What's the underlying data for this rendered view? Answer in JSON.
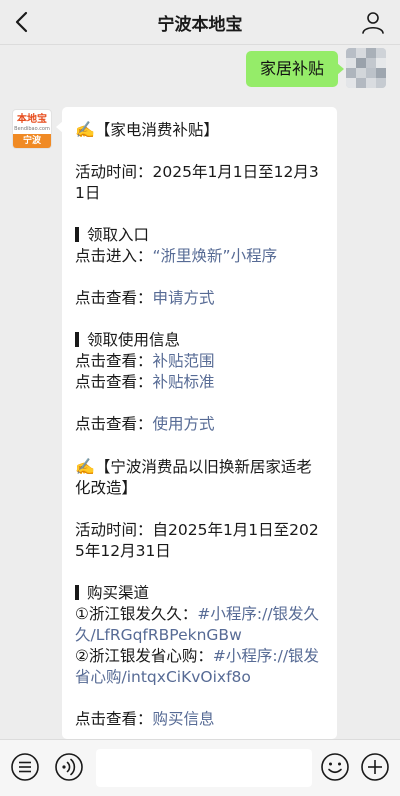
{
  "header": {
    "title": "宁波本地宝"
  },
  "outgoing": {
    "text": "家居补贴"
  },
  "bot_avatar": {
    "logo_text": "本地宝",
    "logo_sub": "Bendibao.com",
    "city": "宁波"
  },
  "reply": {
    "s1_title": "【家电消费补贴】",
    "s1_time": "活动时间：2025年1月1日至12月31日",
    "s1_h1": "领取入口",
    "s1_entry_prefix": "点击进入：",
    "s1_entry_link": "“浙里焕新”小程序",
    "s1_apply_prefix": "点击查看：",
    "s1_apply_link": "申请方式",
    "s1_h2": "领取使用信息",
    "s1_scope_prefix": "点击查看：",
    "s1_scope_link": "补贴范围",
    "s1_std_prefix": "点击查看：",
    "s1_std_link": "补贴标准",
    "s1_use_prefix": "点击查看：",
    "s1_use_link": "使用方式",
    "s2_title": "【宁波消费品以旧换新居家适老化改造】",
    "s2_time": "活动时间：自2025年1月1日至2025年12月31日",
    "s2_h1": "购买渠道",
    "s2_ch1_prefix": "①浙江银发久久：",
    "s2_ch1_link": "#小程序://银发久久/LfRGqfRBPeknGBw",
    "s2_ch2_prefix": "②浙江银发省心购：",
    "s2_ch2_link": "#小程序://银发省心购/intqxCiKvOixf8o",
    "s2_buy_prefix": "点击查看：",
    "s2_buy_link": "购买信息"
  },
  "colors": {
    "outgoing_bubble": "#95ec69",
    "link": "#576b95",
    "background": "#ededed"
  },
  "icons": [
    "back-arrow-icon",
    "profile-icon",
    "writing-hand-icon",
    "voice-icon",
    "emoji-icon",
    "plus-icon"
  ]
}
